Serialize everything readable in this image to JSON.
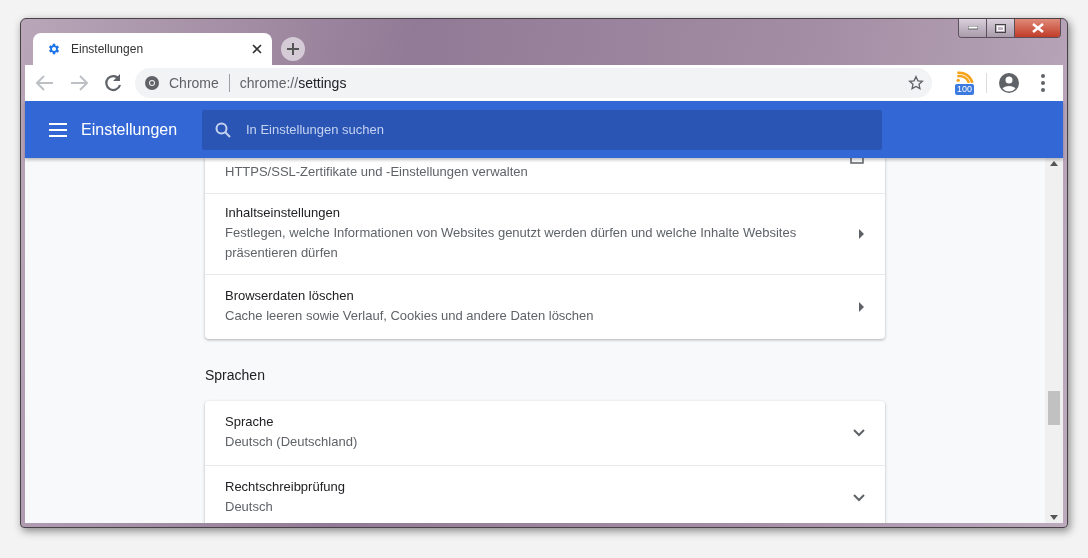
{
  "tabs": [
    {
      "title": "Einstellungen",
      "selected": true
    }
  ],
  "toolbar": {
    "back_disabled": true,
    "forward_disabled": true,
    "site_label": "Chrome",
    "url_scheme": "chrome://",
    "url_path": "settings",
    "extension_badge": "100"
  },
  "header": {
    "title": "Einstellungen",
    "search": {
      "placeholder": "In Einstellungen suchen"
    }
  },
  "sections": [
    {
      "rows": [
        {
          "kind": "external",
          "subtitle": "HTTPS/SSL-Zertifikate und -Einstellungen verwalten"
        },
        {
          "kind": "arrow",
          "title": "Inhaltseinstellungen",
          "subtitle": "Festlegen, welche Informationen von Websites genutzt werden dürfen und welche Inhalte Websites präsentieren dürfen"
        },
        {
          "kind": "arrow",
          "title": "Browserdaten löschen",
          "subtitle": "Cache leeren sowie Verlauf, Cookies und andere Daten löschen"
        }
      ]
    },
    {
      "heading": "Sprachen",
      "rows": [
        {
          "kind": "expand",
          "title": "Sprache",
          "subtitle": "Deutsch (Deutschland)"
        },
        {
          "kind": "expand",
          "title": "Rechtschreibprüfung",
          "subtitle": "Deutsch"
        }
      ]
    }
  ]
}
